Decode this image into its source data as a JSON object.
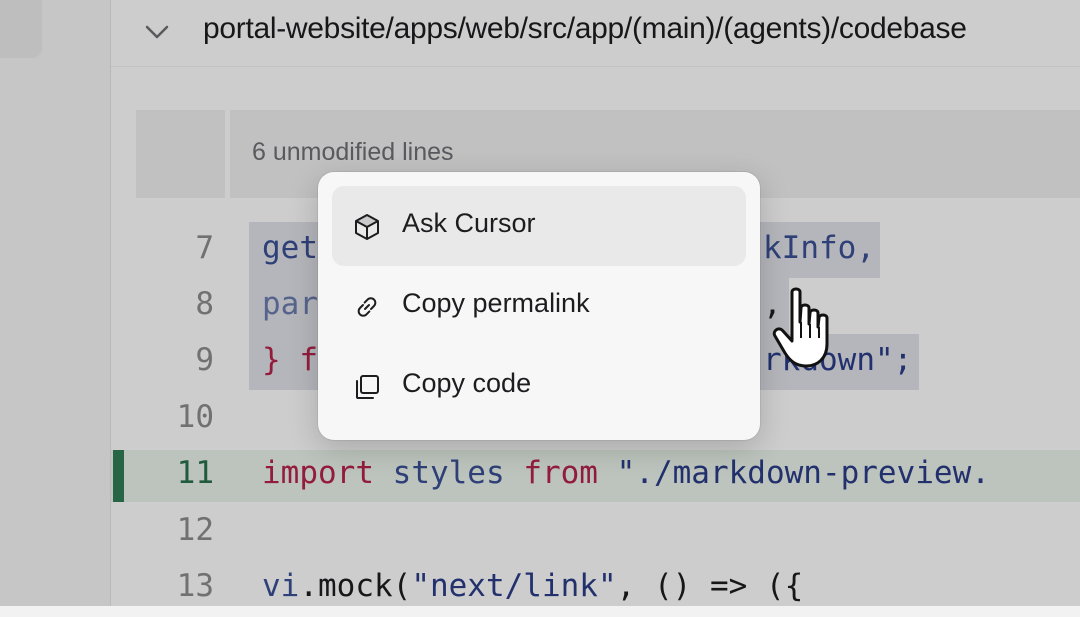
{
  "file_header": {
    "path": "portal-website/apps/web/src/app/(main)/(agents)/codebase",
    "collapse_icon": "chevron-down-icon"
  },
  "diff": {
    "expander_label": "6 unmodified lines",
    "lines": [
      {
        "num": "7",
        "code": "getMarkdownLinkInfo,",
        "visible_start": "get",
        "visible_end": "kInfo,",
        "selected": true
      },
      {
        "num": "8",
        "code": "parse...",
        "visible_start": "par",
        "visible_end": ",",
        "selected": true
      },
      {
        "num": "9",
        "code": "} from \"...markdown\";",
        "visible_start": "} f",
        "visible_end": "rkdown\";",
        "selected": true
      },
      {
        "num": "10",
        "code": ""
      },
      {
        "num": "11",
        "code": "import styles from \"./markdown-preview.",
        "added": true
      },
      {
        "num": "12",
        "code": ""
      },
      {
        "num": "13",
        "code": "vi.mock(\"next/link\", () => ({"
      }
    ]
  },
  "context_menu": {
    "items": [
      {
        "label": "Ask Cursor",
        "icon": "cursor-cube-icon",
        "active": true
      },
      {
        "label": "Copy permalink",
        "icon": "link-icon",
        "active": false
      },
      {
        "label": "Copy code",
        "icon": "copy-icon",
        "active": false
      }
    ]
  },
  "pointer": {
    "icon": "hand-pointer-icon"
  },
  "colors": {
    "added_bar": "#2f7d57",
    "keyword": "#b4234a",
    "identifier": "#3a4f93",
    "selection": "#dcdee5"
  }
}
